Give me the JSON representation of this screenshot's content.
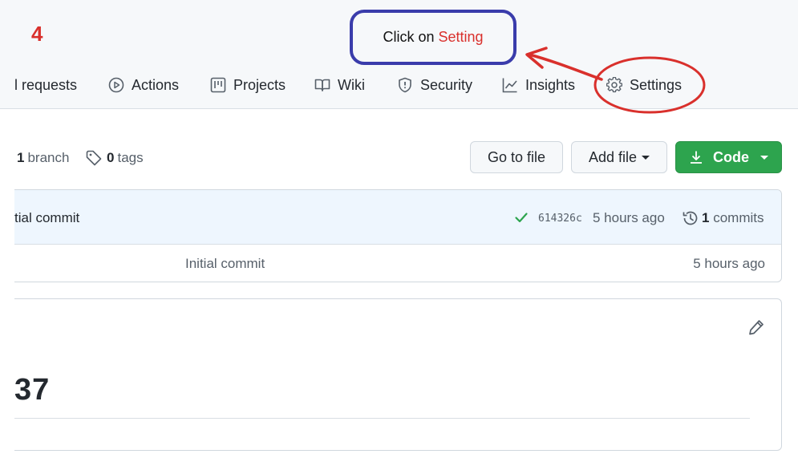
{
  "annotation": {
    "step_number": "4",
    "callout_prefix": "Click on",
    "callout_highlight": "Setting"
  },
  "tabs": [
    {
      "label": "l requests",
      "icon": "pull-request-icon"
    },
    {
      "label": "Actions",
      "icon": "play-icon"
    },
    {
      "label": "Projects",
      "icon": "project-icon"
    },
    {
      "label": "Wiki",
      "icon": "book-icon"
    },
    {
      "label": "Security",
      "icon": "shield-icon"
    },
    {
      "label": "Insights",
      "icon": "graph-icon"
    },
    {
      "label": "Settings",
      "icon": "gear-icon"
    }
  ],
  "repo_meta": {
    "branch_count": "1",
    "branch_label": "branch",
    "tag_count": "0",
    "tag_label": "tags"
  },
  "buttons": {
    "go_to_file": "Go to file",
    "add_file": "Add file",
    "code": "Code"
  },
  "latest_commit": {
    "message": "tial commit",
    "sha": "614326c",
    "time": "5 hours ago",
    "commit_count": "1",
    "commit_label": "commits"
  },
  "files": [
    {
      "message": "Initial commit",
      "time": "5 hours ago"
    }
  ],
  "readme": {
    "heading": "37"
  },
  "colors": {
    "annotation_red": "#d9302c",
    "callout_blue": "#3a3cab",
    "code_button_green": "#2da44e"
  }
}
